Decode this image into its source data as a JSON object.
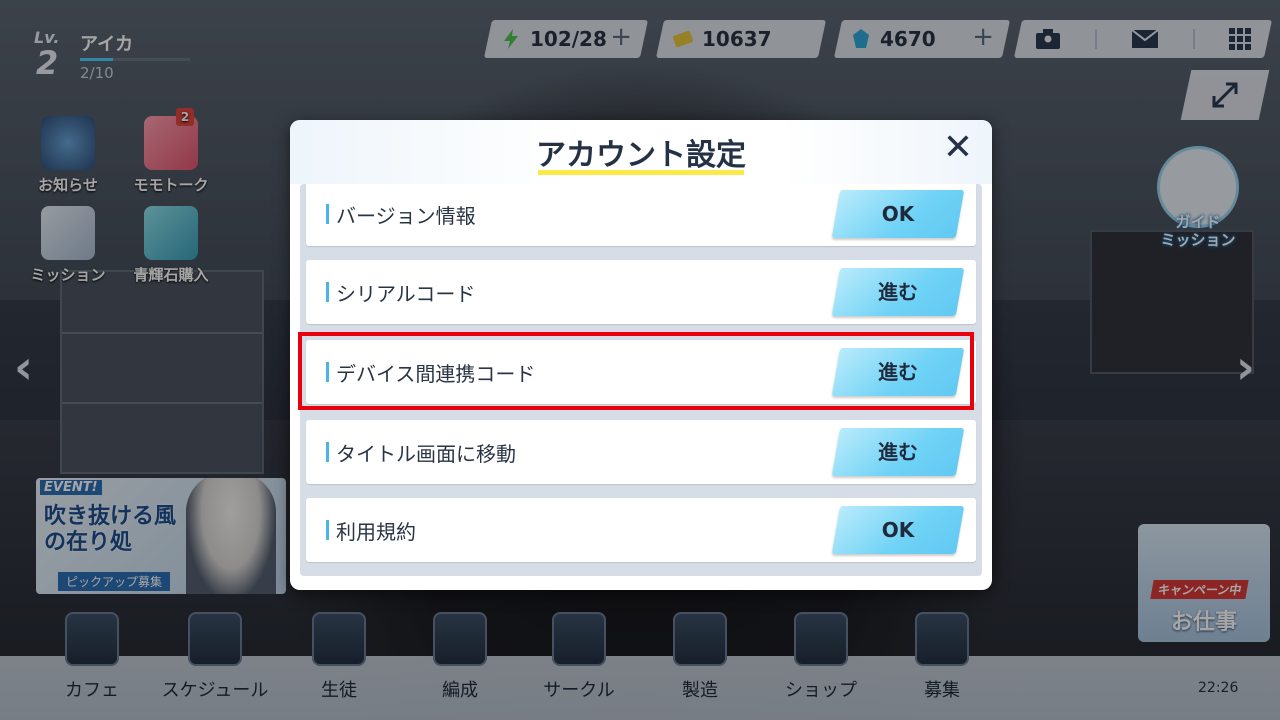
{
  "player": {
    "lv_label": "Lv.",
    "level": "2",
    "name": "アイカ",
    "exp": "2/10"
  },
  "resources": {
    "ap": {
      "icon": "lightning-icon",
      "value": "102/28",
      "plus": "+"
    },
    "credit": {
      "icon": "credit-icon",
      "value": "10637"
    },
    "gem": {
      "icon": "pyroxene-icon",
      "value": "4670",
      "plus": "+"
    }
  },
  "top_right_icons": [
    "profile-icon",
    "mail-icon",
    "menu-grid-icon"
  ],
  "left_menu": [
    {
      "label": "お知らせ",
      "icon": "megaphone-icon"
    },
    {
      "label": "モモトーク",
      "icon": "momotalk-icon",
      "badge": "2"
    },
    {
      "label": "ミッション",
      "icon": "mission-icon"
    },
    {
      "label": "青輝石購入",
      "icon": "shop-bag-icon"
    }
  ],
  "guide": {
    "label1": "ガイド",
    "label2": "ミッション"
  },
  "event": {
    "tag": "EVENT!",
    "title": "吹き抜ける風の在り処",
    "sub": "ピックアップ募集"
  },
  "job": {
    "campaign": "キャンペーン中",
    "label": "お仕事"
  },
  "bottom_nav": [
    {
      "label": "カフェ",
      "icon": "cafe-icon"
    },
    {
      "label": "スケジュール",
      "icon": "schedule-icon"
    },
    {
      "label": "生徒",
      "icon": "student-icon"
    },
    {
      "label": "編成",
      "icon": "formation-icon"
    },
    {
      "label": "サークル",
      "icon": "circle-icon"
    },
    {
      "label": "製造",
      "icon": "craft-icon"
    },
    {
      "label": "ショップ",
      "icon": "shop-icon"
    },
    {
      "label": "募集",
      "icon": "recruit-icon"
    }
  ],
  "clock": "22:26",
  "dialog": {
    "title": "アカウント設定",
    "close": "✕",
    "rows": [
      {
        "label": "バージョン情報",
        "button": "OK"
      },
      {
        "label": "シリアルコード",
        "button": "進む"
      },
      {
        "label": "デバイス間連携コード",
        "button": "進む"
      },
      {
        "label": "タイトル画面に移動",
        "button": "進む"
      },
      {
        "label": "利用規約",
        "button": "OK"
      }
    ]
  }
}
